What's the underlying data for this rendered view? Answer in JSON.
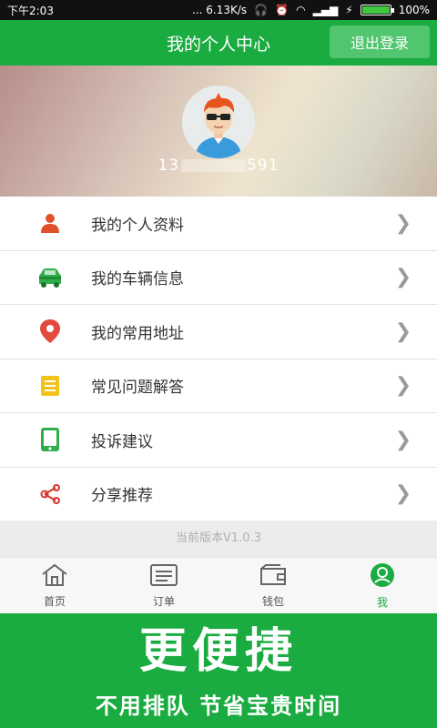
{
  "status_bar": {
    "time": "下午2:03",
    "net_speed": "... 6.13K/s",
    "battery": "100%"
  },
  "header": {
    "title": "我的个人中心",
    "logout_label": "退出登录"
  },
  "profile": {
    "phone_prefix": "13",
    "phone_suffix": "591"
  },
  "menu": {
    "items": [
      {
        "label": "我的个人资料",
        "icon": "person-icon",
        "color": "#e0502a"
      },
      {
        "label": "我的车辆信息",
        "icon": "car-icon",
        "color": "#2fae4a"
      },
      {
        "label": "我的常用地址",
        "icon": "location-pin-icon",
        "color": "#e24a3e"
      },
      {
        "label": "常见问题解答",
        "icon": "document-icon",
        "color": "#f2c21a"
      },
      {
        "label": "投诉建议",
        "icon": "tablet-icon",
        "color": "#2fae4a"
      },
      {
        "label": "分享推荐",
        "icon": "share-icon",
        "color": "#d9342b"
      }
    ]
  },
  "version": "当前版本V1.0.3",
  "tabs": [
    {
      "label": "首页",
      "icon": "home-icon",
      "active": false
    },
    {
      "label": "订单",
      "icon": "orders-icon",
      "active": false
    },
    {
      "label": "钱包",
      "icon": "wallet-icon",
      "active": false
    },
    {
      "label": "我",
      "icon": "profile-icon",
      "active": true
    }
  ],
  "promo": {
    "headline": "更便捷",
    "tagline": "不用排队 节省宝贵时间"
  },
  "colors": {
    "brand_green": "#1aac40",
    "logout_bg": "#51c66f"
  }
}
